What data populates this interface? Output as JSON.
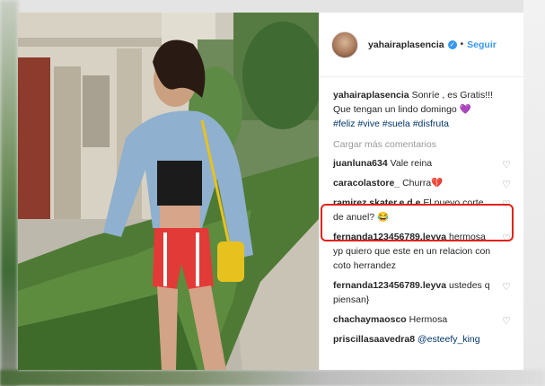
{
  "post": {
    "username": "yahairaplasencia",
    "follow_label": "Seguir",
    "separator": "•",
    "verified_glyph": "✓"
  },
  "caption": {
    "username": "yahairaplasencia",
    "text": "Sonríe , es Gratis!!! Que tengan un lindo domingo",
    "emoji": "💜",
    "hashtags": "#feliz #vive #suela #disfruta"
  },
  "load_more_label": "Cargar más comentarios",
  "like_icon": "♡",
  "comments": [
    {
      "user": "juanluna634",
      "text": "Vale reina"
    },
    {
      "user": "caracolastore_",
      "text": "Churra💔"
    },
    {
      "user": "ramirez.skater.e.d.e",
      "text": "El nuevo corte de anuel? 😂"
    },
    {
      "user": "fernanda123456789.leyva",
      "text": "hermosa yp quiero que este en un relacion con coto herrandez"
    },
    {
      "user": "fernanda123456789.leyva",
      "text": "ustedes q piensan}"
    },
    {
      "user": "chachaymaosco",
      "text": "Hermosa"
    },
    {
      "user": "priscillasaavedra8",
      "text": "@esteefy_king"
    }
  ],
  "colors": {
    "accent": "#3897f0",
    "highlight": "#e0231c",
    "hashtag": "#003569",
    "muted": "#999999"
  }
}
